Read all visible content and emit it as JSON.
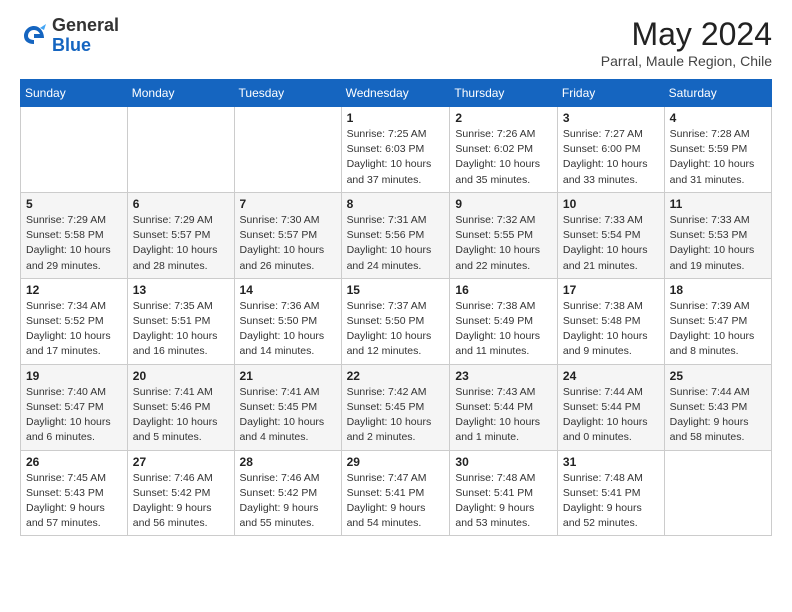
{
  "header": {
    "logo_line1": "General",
    "logo_line2": "Blue",
    "month_year": "May 2024",
    "location": "Parral, Maule Region, Chile"
  },
  "days_of_week": [
    "Sunday",
    "Monday",
    "Tuesday",
    "Wednesday",
    "Thursday",
    "Friday",
    "Saturday"
  ],
  "weeks": [
    [
      {
        "day": "",
        "info": ""
      },
      {
        "day": "",
        "info": ""
      },
      {
        "day": "",
        "info": ""
      },
      {
        "day": "1",
        "info": "Sunrise: 7:25 AM\nSunset: 6:03 PM\nDaylight: 10 hours\nand 37 minutes."
      },
      {
        "day": "2",
        "info": "Sunrise: 7:26 AM\nSunset: 6:02 PM\nDaylight: 10 hours\nand 35 minutes."
      },
      {
        "day": "3",
        "info": "Sunrise: 7:27 AM\nSunset: 6:00 PM\nDaylight: 10 hours\nand 33 minutes."
      },
      {
        "day": "4",
        "info": "Sunrise: 7:28 AM\nSunset: 5:59 PM\nDaylight: 10 hours\nand 31 minutes."
      }
    ],
    [
      {
        "day": "5",
        "info": "Sunrise: 7:29 AM\nSunset: 5:58 PM\nDaylight: 10 hours\nand 29 minutes."
      },
      {
        "day": "6",
        "info": "Sunrise: 7:29 AM\nSunset: 5:57 PM\nDaylight: 10 hours\nand 28 minutes."
      },
      {
        "day": "7",
        "info": "Sunrise: 7:30 AM\nSunset: 5:57 PM\nDaylight: 10 hours\nand 26 minutes."
      },
      {
        "day": "8",
        "info": "Sunrise: 7:31 AM\nSunset: 5:56 PM\nDaylight: 10 hours\nand 24 minutes."
      },
      {
        "day": "9",
        "info": "Sunrise: 7:32 AM\nSunset: 5:55 PM\nDaylight: 10 hours\nand 22 minutes."
      },
      {
        "day": "10",
        "info": "Sunrise: 7:33 AM\nSunset: 5:54 PM\nDaylight: 10 hours\nand 21 minutes."
      },
      {
        "day": "11",
        "info": "Sunrise: 7:33 AM\nSunset: 5:53 PM\nDaylight: 10 hours\nand 19 minutes."
      }
    ],
    [
      {
        "day": "12",
        "info": "Sunrise: 7:34 AM\nSunset: 5:52 PM\nDaylight: 10 hours\nand 17 minutes."
      },
      {
        "day": "13",
        "info": "Sunrise: 7:35 AM\nSunset: 5:51 PM\nDaylight: 10 hours\nand 16 minutes."
      },
      {
        "day": "14",
        "info": "Sunrise: 7:36 AM\nSunset: 5:50 PM\nDaylight: 10 hours\nand 14 minutes."
      },
      {
        "day": "15",
        "info": "Sunrise: 7:37 AM\nSunset: 5:50 PM\nDaylight: 10 hours\nand 12 minutes."
      },
      {
        "day": "16",
        "info": "Sunrise: 7:38 AM\nSunset: 5:49 PM\nDaylight: 10 hours\nand 11 minutes."
      },
      {
        "day": "17",
        "info": "Sunrise: 7:38 AM\nSunset: 5:48 PM\nDaylight: 10 hours\nand 9 minutes."
      },
      {
        "day": "18",
        "info": "Sunrise: 7:39 AM\nSunset: 5:47 PM\nDaylight: 10 hours\nand 8 minutes."
      }
    ],
    [
      {
        "day": "19",
        "info": "Sunrise: 7:40 AM\nSunset: 5:47 PM\nDaylight: 10 hours\nand 6 minutes."
      },
      {
        "day": "20",
        "info": "Sunrise: 7:41 AM\nSunset: 5:46 PM\nDaylight: 10 hours\nand 5 minutes."
      },
      {
        "day": "21",
        "info": "Sunrise: 7:41 AM\nSunset: 5:45 PM\nDaylight: 10 hours\nand 4 minutes."
      },
      {
        "day": "22",
        "info": "Sunrise: 7:42 AM\nSunset: 5:45 PM\nDaylight: 10 hours\nand 2 minutes."
      },
      {
        "day": "23",
        "info": "Sunrise: 7:43 AM\nSunset: 5:44 PM\nDaylight: 10 hours\nand 1 minute."
      },
      {
        "day": "24",
        "info": "Sunrise: 7:44 AM\nSunset: 5:44 PM\nDaylight: 10 hours\nand 0 minutes."
      },
      {
        "day": "25",
        "info": "Sunrise: 7:44 AM\nSunset: 5:43 PM\nDaylight: 9 hours\nand 58 minutes."
      }
    ],
    [
      {
        "day": "26",
        "info": "Sunrise: 7:45 AM\nSunset: 5:43 PM\nDaylight: 9 hours\nand 57 minutes."
      },
      {
        "day": "27",
        "info": "Sunrise: 7:46 AM\nSunset: 5:42 PM\nDaylight: 9 hours\nand 56 minutes."
      },
      {
        "day": "28",
        "info": "Sunrise: 7:46 AM\nSunset: 5:42 PM\nDaylight: 9 hours\nand 55 minutes."
      },
      {
        "day": "29",
        "info": "Sunrise: 7:47 AM\nSunset: 5:41 PM\nDaylight: 9 hours\nand 54 minutes."
      },
      {
        "day": "30",
        "info": "Sunrise: 7:48 AM\nSunset: 5:41 PM\nDaylight: 9 hours\nand 53 minutes."
      },
      {
        "day": "31",
        "info": "Sunrise: 7:48 AM\nSunset: 5:41 PM\nDaylight: 9 hours\nand 52 minutes."
      },
      {
        "day": "",
        "info": ""
      }
    ]
  ]
}
